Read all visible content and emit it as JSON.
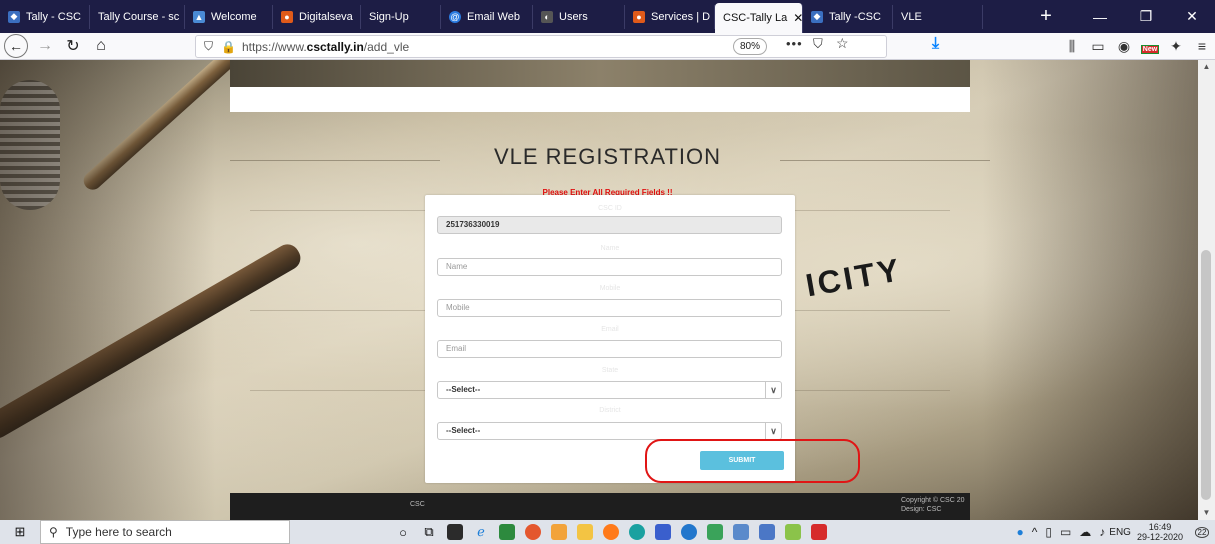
{
  "browser": {
    "tabs": [
      {
        "label": "Tally - CSC",
        "icon": "tally-icon",
        "color": "#3b6fc0"
      },
      {
        "label": "Tally Course - sc",
        "icon": "none",
        "color": ""
      },
      {
        "label": "Welcome",
        "icon": "welcome-icon",
        "color": "#4a8ad4"
      },
      {
        "label": "Digitalseva",
        "icon": "digitalseva-icon",
        "color": "#e05a1a"
      },
      {
        "label": "Sign-Up",
        "icon": "none",
        "color": ""
      },
      {
        "label": "Email Web",
        "icon": "email-icon",
        "color": "#2a7be0"
      },
      {
        "label": "Users",
        "icon": "users-icon",
        "color": "#555555"
      },
      {
        "label": "Services | D",
        "icon": "services-icon",
        "color": "#e05a1a"
      },
      {
        "label": "CSC-Tally La",
        "icon": "none",
        "color": "",
        "active": true
      },
      {
        "label": "Tally -CSC",
        "icon": "tally-icon",
        "color": "#3b6fc0"
      },
      {
        "label": "VLE",
        "icon": "none",
        "color": ""
      }
    ],
    "new_tab_label": "+",
    "window_controls": [
      "—",
      "❐",
      "✕"
    ],
    "url_prefix": "https://www.",
    "url_host": "csctally.in",
    "url_path": "/add_vle",
    "zoom": "80%",
    "more_label": "•••",
    "new_badge": "New"
  },
  "page": {
    "title": "VLE REGISTRATION",
    "required_msg": "Please Enter All Required Fields !!",
    "background_word": "ICITY",
    "form": {
      "id_value": "251736330019",
      "name_placeholder": "Name",
      "mobile_placeholder": "Mobile",
      "email_placeholder": "Email",
      "select1_value": "--Select--",
      "select2_value": "--Select--",
      "submit_label": "SUBMIT",
      "ghost_labels": [
        "CSC ID",
        "Name",
        "Mobile",
        "Email",
        "State",
        "District"
      ]
    },
    "footer": {
      "left": "CSC",
      "right_line1": "Copyright © CSC 20",
      "right_line2": "Design: CSC"
    }
  },
  "taskbar": {
    "search_placeholder": "Type here to search",
    "lang": "ENG",
    "time": "16:49",
    "date": "29-12-2020",
    "notification_count": "22"
  },
  "colors": {
    "tabstrip": "#1d1d45",
    "submit": "#5bc0de",
    "highlight": "#e01515",
    "required": "#e01010"
  }
}
